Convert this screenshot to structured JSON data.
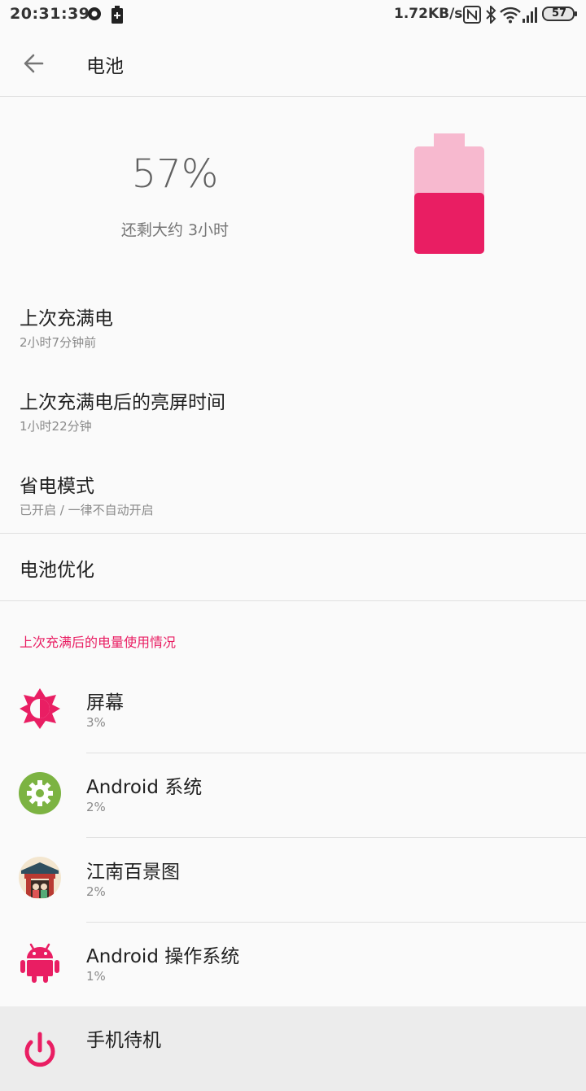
{
  "status_bar": {
    "time": "20:31:39",
    "net_speed": "1.72KB/s",
    "battery_level": "57"
  },
  "toolbar": {
    "title": "电池"
  },
  "battery": {
    "percent": "57%",
    "remaining": "还剩大约 3小时",
    "level_fraction": 0.57,
    "color_full": "#e91e63",
    "color_empty": "#f7b9cf"
  },
  "info_items": [
    {
      "title": "上次充满电",
      "sub": "2小时7分钟前"
    },
    {
      "title": "上次充满电后的亮屏时间",
      "sub": "1小时22分钟"
    },
    {
      "title": "省电模式",
      "sub": "已开启 / 一律不自动开启"
    }
  ],
  "optimization": {
    "title": "电池优化"
  },
  "usage": {
    "header": "上次充满后的电量使用情况",
    "accent": "#e91e63",
    "items": [
      {
        "title": "屏幕",
        "pct": "3%",
        "icon": "brightness-icon"
      },
      {
        "title": "Android 系统",
        "pct": "2%",
        "icon": "android-system-gear-icon"
      },
      {
        "title": "江南百景图",
        "pct": "2%",
        "icon": "jiangnan-app-icon"
      },
      {
        "title": "Android 操作系统",
        "pct": "1%",
        "icon": "android-robot-icon"
      },
      {
        "title": "手机待机",
        "pct": "",
        "icon": "power-icon"
      }
    ]
  }
}
